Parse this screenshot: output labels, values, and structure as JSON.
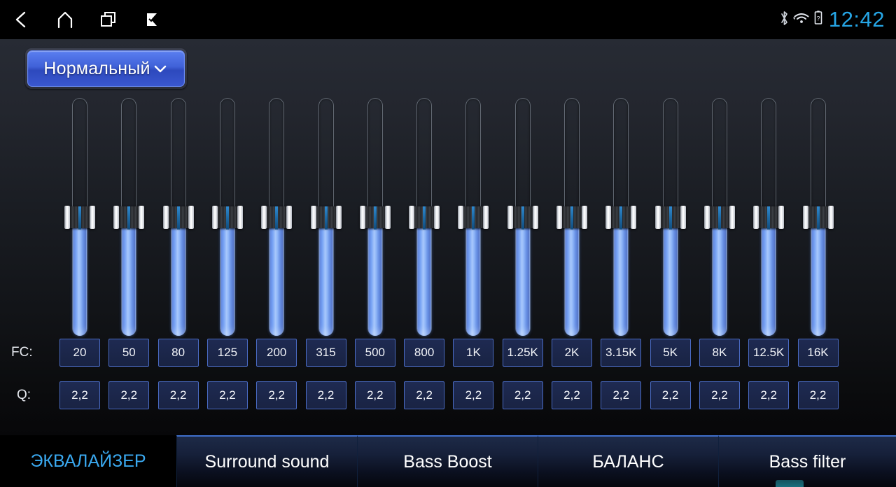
{
  "statusbar": {
    "nav": [
      {
        "name": "back-icon",
        "label": "Back"
      },
      {
        "name": "home-icon",
        "label": "Home"
      },
      {
        "name": "recents-icon",
        "label": "Recent apps"
      },
      {
        "name": "flag-check-icon",
        "label": "Flag"
      }
    ],
    "icons": [
      {
        "name": "bluetooth-icon",
        "label": "Bluetooth"
      },
      {
        "name": "wifi-icon",
        "label": "Wi-Fi"
      },
      {
        "name": "battery-unknown-icon",
        "label": "Battery"
      }
    ],
    "time": "12:42",
    "clock_color": "#26a6e6"
  },
  "preset": {
    "label": "Нормальный",
    "chevron": "chevron-down-icon",
    "accent": "#4061d8"
  },
  "equalizer": {
    "fc_label": "FC:",
    "q_label": "Q:",
    "bands": [
      {
        "fc": "20",
        "q": "2,2",
        "level": 50
      },
      {
        "fc": "50",
        "q": "2,2",
        "level": 50
      },
      {
        "fc": "80",
        "q": "2,2",
        "level": 50
      },
      {
        "fc": "125",
        "q": "2,2",
        "level": 50
      },
      {
        "fc": "200",
        "q": "2,2",
        "level": 50
      },
      {
        "fc": "315",
        "q": "2,2",
        "level": 50
      },
      {
        "fc": "500",
        "q": "2,2",
        "level": 50
      },
      {
        "fc": "800",
        "q": "2,2",
        "level": 50
      },
      {
        "fc": "1K",
        "q": "2,2",
        "level": 50
      },
      {
        "fc": "1.25K",
        "q": "2,2",
        "level": 50
      },
      {
        "fc": "2K",
        "q": "2,2",
        "level": 50
      },
      {
        "fc": "3.15K",
        "q": "2,2",
        "level": 50
      },
      {
        "fc": "5K",
        "q": "2,2",
        "level": 50
      },
      {
        "fc": "8K",
        "q": "2,2",
        "level": 50
      },
      {
        "fc": "12.5K",
        "q": "2,2",
        "level": 50
      },
      {
        "fc": "16K",
        "q": "2,2",
        "level": 50
      }
    ],
    "slider_fill_color": "#6e9cf4"
  },
  "tabs": [
    {
      "id": "tab-eq",
      "label": "ЭКВАЛАЙЗЕР",
      "active": true
    },
    {
      "id": "tab-surround",
      "label": "Surround sound",
      "active": false
    },
    {
      "id": "tab-bass",
      "label": "Bass Boost",
      "active": false
    },
    {
      "id": "tab-balance",
      "label": "БАЛАНС",
      "active": false
    },
    {
      "id": "tab-filter",
      "label": "Bass filter",
      "active": false
    }
  ],
  "tab_active_color": "#3aa9f0"
}
